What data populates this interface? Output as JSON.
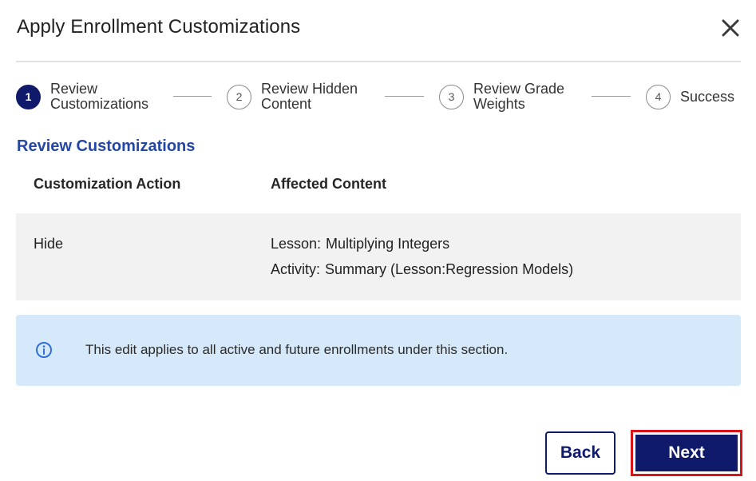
{
  "dialog": {
    "title": "Apply Enrollment Customizations",
    "close_icon": "close-icon"
  },
  "stepper": {
    "steps": [
      {
        "number": "1",
        "label": "Review\nCustomizations",
        "state": "active"
      },
      {
        "number": "2",
        "label": "Review Hidden\nContent",
        "state": "upcoming"
      },
      {
        "number": "3",
        "label": "Review Grade\nWeights",
        "state": "upcoming"
      },
      {
        "number": "4",
        "label": "Success",
        "state": "upcoming"
      }
    ]
  },
  "section": {
    "title": "Review Customizations"
  },
  "table": {
    "headers": [
      "Customization Action",
      "Affected Content"
    ],
    "rows": [
      {
        "action": "Hide",
        "content": [
          {
            "key": "Lesson:",
            "value": "Multiplying Integers"
          },
          {
            "key": "Activity:",
            "value": "Summary (Lesson:Regression Models)"
          }
        ]
      }
    ]
  },
  "info": {
    "icon": "info-icon",
    "text": "This edit applies to all active and future enrollments under this section."
  },
  "footer": {
    "back_label": "Back",
    "next_label": "Next"
  },
  "colors": {
    "primary": "#0f1a6b",
    "section_title": "#2446a6",
    "info_bg": "#d5e9fb",
    "highlight_border": "#d8141b"
  }
}
